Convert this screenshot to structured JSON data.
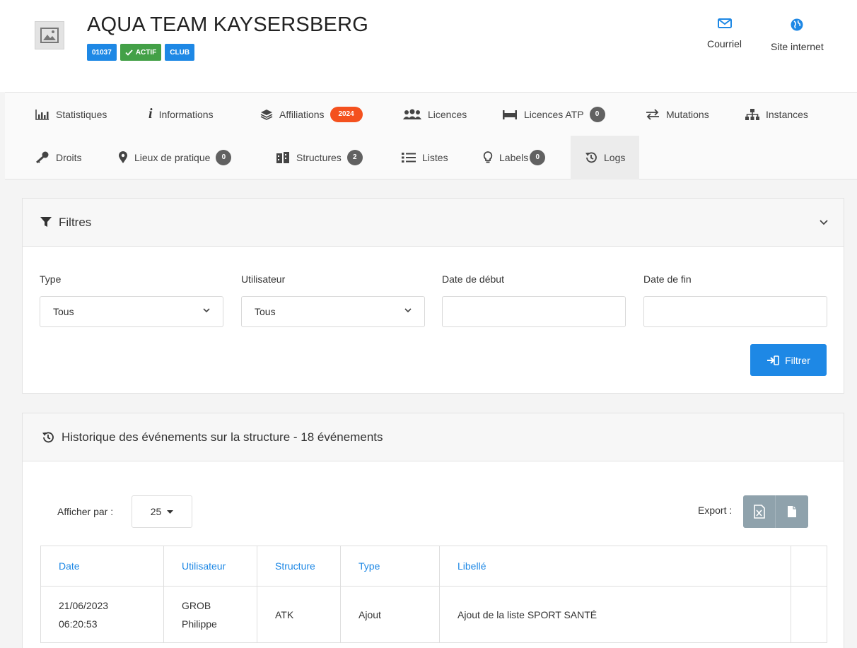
{
  "header": {
    "title": "AQUA TEAM KAYSERSBERG",
    "badges": {
      "code": "01037",
      "status": "ACTIF",
      "kind": "CLUB"
    },
    "links": {
      "email": "Courriel",
      "website": "Site internet"
    }
  },
  "tabs": {
    "statistiques": "Statistiques",
    "informations": "Informations",
    "affiliations": "Affiliations",
    "affiliations_count": "2024",
    "licences": "Licences",
    "licences_atp": "Licences ATP",
    "licences_atp_count": "0",
    "mutations": "Mutations",
    "instances": "Instances",
    "droits": "Droits",
    "lieux": "Lieux de pratique",
    "lieux_count": "0",
    "structures": "Structures",
    "structures_count": "2",
    "listes": "Listes",
    "labels": "Labels",
    "labels_count": "0",
    "logs": "Logs"
  },
  "filters": {
    "title": "Filtres",
    "type_label": "Type",
    "type_value": "Tous",
    "user_label": "Utilisateur",
    "user_value": "Tous",
    "start_label": "Date de début",
    "end_label": "Date de fin",
    "button": "Filtrer"
  },
  "history": {
    "title": "Historique des événements sur la structure - 18 événements",
    "per_page_label": "Afficher par :",
    "per_page_value": "25",
    "export_label": "Export :",
    "columns": {
      "date": "Date",
      "user": "Utilisateur",
      "structure": "Structure",
      "type": "Type",
      "label": "Libellé"
    },
    "rows": [
      {
        "date": "21/06/2023",
        "time": "06:20:53",
        "user_last": "GROB",
        "user_first": "Philippe",
        "structure": "ATK",
        "type": "Ajout",
        "label": "Ajout de la liste SPORT SANTÉ"
      }
    ]
  }
}
